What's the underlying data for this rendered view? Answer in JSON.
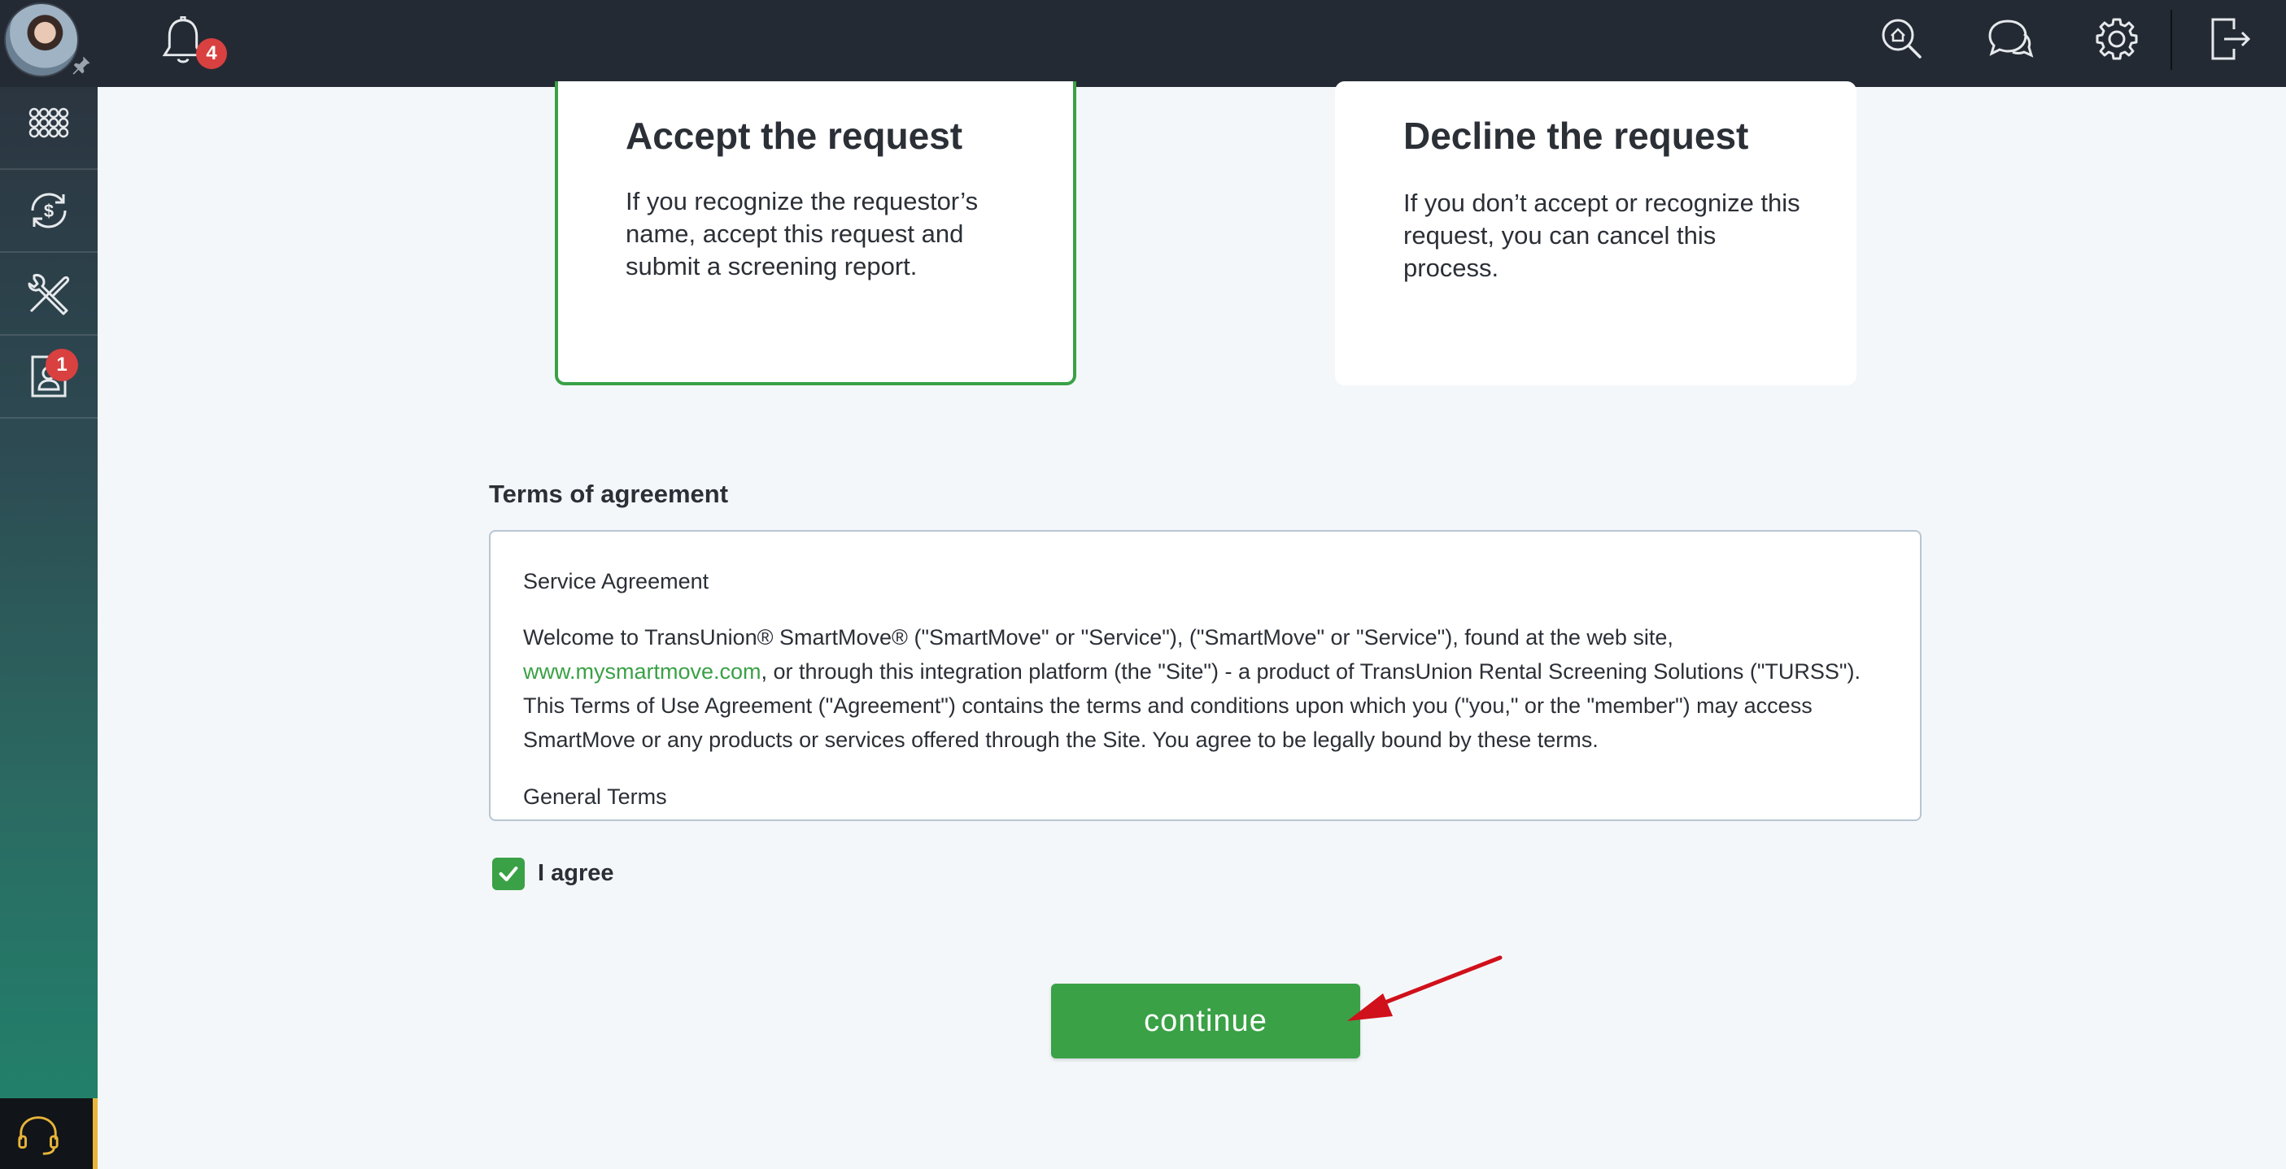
{
  "topbar": {
    "notification_count": "4",
    "icons": [
      "avatar",
      "pin-icon",
      "bell-icon",
      "search-home-icon",
      "chat-icon",
      "gear-icon",
      "logout-icon"
    ]
  },
  "sidebar": {
    "items": [
      {
        "icon": "apps-grid-icon"
      },
      {
        "icon": "payment-refresh-icon"
      },
      {
        "icon": "tools-icon"
      },
      {
        "icon": "tenant-document-icon",
        "badge": "1"
      }
    ],
    "support_icon": "headset-icon"
  },
  "cards": {
    "accept": {
      "title": "Accept the request",
      "description": "If you recognize the requestor’s name, accept this request and submit a screening report."
    },
    "decline": {
      "title": "Decline the request",
      "description": "If you don’t accept or recognize this request, you can cancel this process."
    }
  },
  "terms": {
    "label": "Terms of agreement",
    "heading": "Service Agreement",
    "body_part1": "Welcome to TransUnion® SmartMove® (\"SmartMove\" or \"Service\"), (\"SmartMove\" or \"Service\"), found at the web site, ",
    "link": "www.mysmartmove.com",
    "body_part2": ", or through this integration platform (the \"Site\") - a product of TransUnion Rental Screening Solutions (\"TURSS\"). This Terms of Use Agreement (\"Agreement\") contains the terms and conditions upon which you (\"you,\" or the \"member\") may access SmartMove or any products or services offered through the Site. You agree to be legally bound by these terms.",
    "subheading": "General Terms"
  },
  "agree": {
    "label": "I agree",
    "checked": true
  },
  "continue_label": "continue",
  "colors": {
    "accent_green": "#3aa146",
    "topbar": "#242a33",
    "badge_red": "#d94040",
    "annotation_arrow": "#d0101a"
  }
}
